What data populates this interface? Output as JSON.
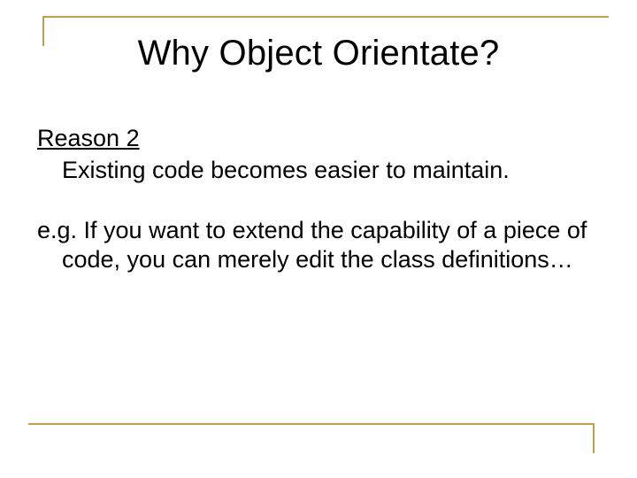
{
  "slide": {
    "title": "Why Object Orientate?",
    "heading": "Reason 2",
    "line1": "Existing code becomes easier to maintain.",
    "line2": "e.g. If you want to extend the capability of a piece of code, you can merely edit the class definitions…"
  }
}
